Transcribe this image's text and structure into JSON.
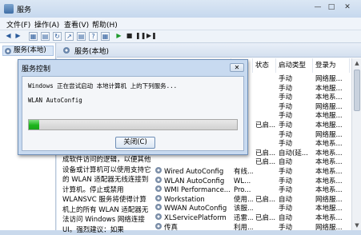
{
  "window": {
    "title": "服务"
  },
  "menu": [
    "文件(F)",
    "操作(A)",
    "查看(V)",
    "帮助(H)"
  ],
  "nav": {
    "item": "服务(本地)"
  },
  "content": {
    "header": "服务(本地)"
  },
  "description": "成软件访问的逻辑，以便其他设备或计算机可以使用支持它的 WLAN 适配器无线连接到计算机。停止或禁用 WLANSVC 服务将使得计算机上的所有 WLAN 适配器无法访问 Windows 网络连接 UI。强烈建议：如果",
  "columns": [
    "",
    "",
    "状态",
    "启动类型",
    "登录为"
  ],
  "rows": [
    {
      "name": "",
      "desc": "",
      "status": "",
      "startup": "手动",
      "logon": "网络服..."
    },
    {
      "name": "",
      "desc": "",
      "status": "",
      "startup": "手动",
      "logon": "本地服..."
    },
    {
      "name": "",
      "desc": "",
      "status": "",
      "startup": "手动",
      "logon": "本地系..."
    },
    {
      "name": "",
      "desc": "",
      "status": "",
      "startup": "手动",
      "logon": "网络服..."
    },
    {
      "name": "",
      "desc": "",
      "status": "",
      "startup": "手动",
      "logon": "本地服..."
    },
    {
      "name": "",
      "desc": "",
      "status": "已启...",
      "startup": "手动",
      "logon": "本地服..."
    },
    {
      "name": "",
      "desc": "",
      "status": "",
      "startup": "手动",
      "logon": "网络服..."
    },
    {
      "name": "",
      "desc": "",
      "status": "",
      "startup": "手动",
      "logon": "本地系..."
    },
    {
      "name": "",
      "desc": "",
      "status": "已启...",
      "startup": "自动(延...",
      "logon": "本地系..."
    },
    {
      "name": "",
      "desc": "",
      "status": "已启...",
      "startup": "自动",
      "logon": "本地系..."
    },
    {
      "name": "Wired AutoConfig",
      "desc": "有线...",
      "status": "",
      "startup": "手动",
      "logon": "本地系..."
    },
    {
      "name": "WLAN AutoConfig",
      "desc": "WL...",
      "status": "",
      "startup": "手动",
      "logon": "本地系..."
    },
    {
      "name": "WMI Performance...",
      "desc": "Pro...",
      "status": "",
      "startup": "手动",
      "logon": "本地系..."
    },
    {
      "name": "Workstation",
      "desc": "使用...",
      "status": "已启...",
      "startup": "自动",
      "logon": "网络服..."
    },
    {
      "name": "WWAN AutoConfig",
      "desc": "该服...",
      "status": "",
      "startup": "手动",
      "logon": "本地服..."
    },
    {
      "name": "XLServicePlatform",
      "desc": "迅雷...",
      "status": "已启...",
      "startup": "自动",
      "logon": "本地系..."
    },
    {
      "name": "传真",
      "desc": "利用...",
      "status": "",
      "startup": "手动",
      "logon": "网络服..."
    }
  ],
  "dialog": {
    "title": "服务控制",
    "message": "Windows 正在尝试启动 本地计算机 上的下列服务...",
    "service": "WLAN AutoConfig",
    "close_button": "关闭(C)",
    "progress": 0.05
  }
}
